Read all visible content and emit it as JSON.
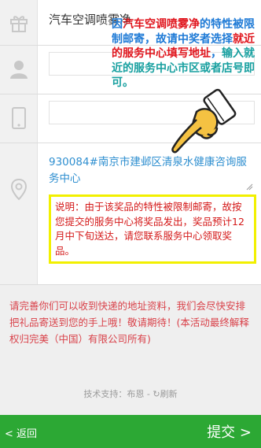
{
  "form": {
    "prize_name": "汽车空调喷雾净",
    "address": "930084#南京市建邺区清泉水健康咨询服务中心",
    "note": "说明：由于该奖品的特性被限制邮寄，故按您提交的服务中心将奖品发出，奖品预计12月中下旬送达，请您联系服务中心领取奖品。"
  },
  "annotation": {
    "part1": "因",
    "part2": "汽车空调喷雾净",
    "part3": "的特性被限制邮寄，故请中奖者选择",
    "part4": "就近的服务中心填写地址",
    "part5": "，",
    "part6": "输入就近的服务中心市区或者店号即可。"
  },
  "notice": "请完善你们可以收到快递的地址资料，我们会尽快安排把礼品寄送到您的手上哦！敬请期待！(本活动最终解释权归完美（中国）有限公司所有)",
  "footer": {
    "support_prefix": "技术支持：",
    "support_name": "布恩",
    "support_sep": " - ",
    "refresh_symbol": "↻",
    "refresh_label": "刷新"
  },
  "bottom_bar": {
    "back_label": "< 返回",
    "submit_label": "提交 >",
    "color": "#2ca834"
  },
  "icons": [
    "gift-icon",
    "user-icon",
    "phone-icon",
    "location-pin-icon",
    "pointing-hand-icon",
    "refresh-icon"
  ],
  "colors": {
    "annotation_blue": "#1e7ad6",
    "annotation_red": "#e0151d",
    "annotation_teal": "#18a0a0",
    "note_border": "#f2f000",
    "note_text": "#d41818",
    "address_text": "#2f8fd0",
    "notice_text": "#d9424a"
  }
}
